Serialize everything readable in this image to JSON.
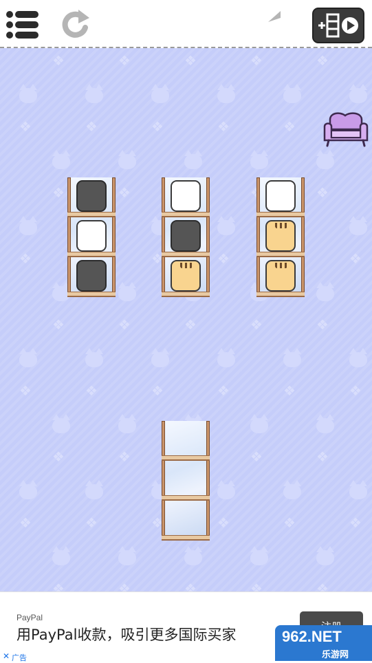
{
  "toolbar": {
    "menu_icon": "list-menu-icon",
    "restart_icon": "restart-icon",
    "undo_icon": "undo-arrow-icon",
    "add_shelf_icon": "add-shelf-video-icon"
  },
  "decor": {
    "sofa_icon": "sofa-icon"
  },
  "shelves": [
    {
      "name": "shelf-1",
      "slots": [
        "black",
        "white",
        "black"
      ]
    },
    {
      "name": "shelf-2",
      "slots": [
        "white",
        "black",
        "tabby"
      ]
    },
    {
      "name": "shelf-3",
      "slots": [
        "white",
        "tabby",
        "tabby"
      ]
    },
    {
      "name": "shelf-4",
      "slots": [
        "",
        "",
        ""
      ]
    }
  ],
  "colors": {
    "background": "#c5cdfa",
    "black_cat": "#555555",
    "white_cat": "#ffffff",
    "tabby_cat": "#f9d48f",
    "wood": "#c9946a"
  },
  "ad": {
    "sponsor": "PayPal",
    "title": "用PayPal收款，吸引更多国际买家",
    "cta": "注册",
    "close": "✕",
    "label": "广告"
  },
  "watermark": {
    "top": "962.NET",
    "bottom": "乐游网"
  }
}
